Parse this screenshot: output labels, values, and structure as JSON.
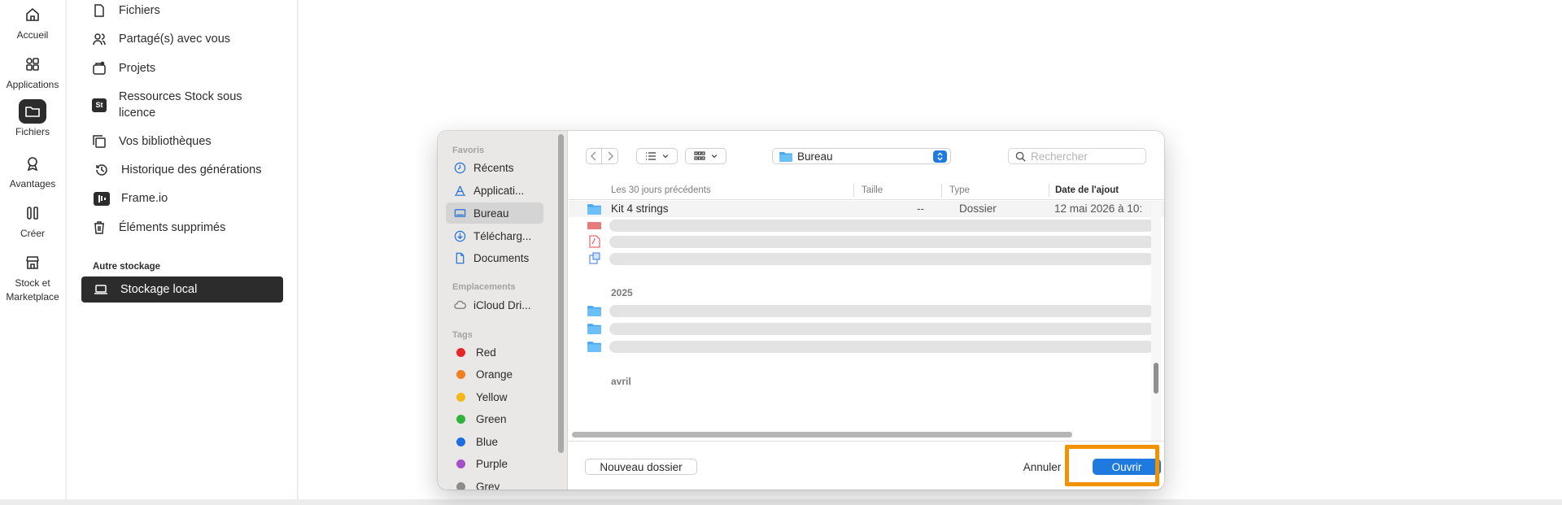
{
  "rail": {
    "items": [
      {
        "label": "Accueil",
        "icon": "home-icon"
      },
      {
        "label": "Applications",
        "icon": "apps-icon"
      },
      {
        "label": "Fichiers",
        "icon": "folder-icon"
      },
      {
        "label": "Avantages",
        "icon": "award-icon"
      },
      {
        "label": "Créer",
        "icon": "create-icon"
      },
      {
        "label": "Stock et Marketplace",
        "icon": "store-icon"
      }
    ]
  },
  "nav": {
    "items": [
      {
        "label": "Fichiers",
        "icon": "file-icon"
      },
      {
        "label": "Partagé(s) avec vous",
        "icon": "people-icon"
      },
      {
        "label": "Projets",
        "icon": "projects-icon"
      },
      {
        "label": "Ressources Stock sous licence",
        "icon": "stock-badge-icon",
        "badge": "St"
      },
      {
        "label": "Vos bibliothèques",
        "icon": "library-icon"
      },
      {
        "label": "Historique des générations",
        "icon": "history-icon"
      },
      {
        "label": "Frame.io",
        "icon": "frameio-icon"
      },
      {
        "label": "Éléments supprimés",
        "icon": "trash-icon"
      }
    ],
    "section_title": "Autre stockage",
    "selected_label": "Stockage local"
  },
  "dialog": {
    "sidebar": {
      "favoris_title": "Favoris",
      "favoris": [
        {
          "label": "Récents",
          "icon": "clock-icon"
        },
        {
          "label": "Applicati...",
          "icon": "applications-icon"
        },
        {
          "label": "Bureau",
          "icon": "desktop-icon"
        },
        {
          "label": "Télécharg...",
          "icon": "download-icon"
        },
        {
          "label": "Documents",
          "icon": "document-icon"
        }
      ],
      "emplacements_title": "Emplacements",
      "emplacements": [
        {
          "label": "iCloud Dri...",
          "icon": "cloud-icon"
        }
      ],
      "tags_title": "Tags",
      "tags": [
        {
          "label": "Red",
          "color": "#e5252a"
        },
        {
          "label": "Orange",
          "color": "#f0801f"
        },
        {
          "label": "Yellow",
          "color": "#f4b81c"
        },
        {
          "label": "Green",
          "color": "#2fb33a"
        },
        {
          "label": "Blue",
          "color": "#1e6ee0"
        },
        {
          "label": "Purple",
          "color": "#a450c9"
        },
        {
          "label": "Grey",
          "color": "#8c8c8c"
        }
      ]
    },
    "toolbar": {
      "path": "Bureau",
      "search_placeholder": "Rechercher"
    },
    "columns": {
      "name": "Les 30 jours précédents",
      "size": "Taille",
      "type": "Type",
      "date": "Date de l'ajout"
    },
    "rows": [
      {
        "name": "Kit 4 strings",
        "size": "--",
        "type": "Dossier",
        "date": "12 mai 2026 à 10:"
      }
    ],
    "groups": [
      "2025",
      "avril"
    ],
    "footer": {
      "new_folder": "Nouveau dossier",
      "cancel": "Annuler",
      "open": "Ouvrir"
    }
  },
  "colors": {
    "accent": "#1f7ae0",
    "highlight": "#f39200",
    "rail_active": "#2c2c2c"
  }
}
